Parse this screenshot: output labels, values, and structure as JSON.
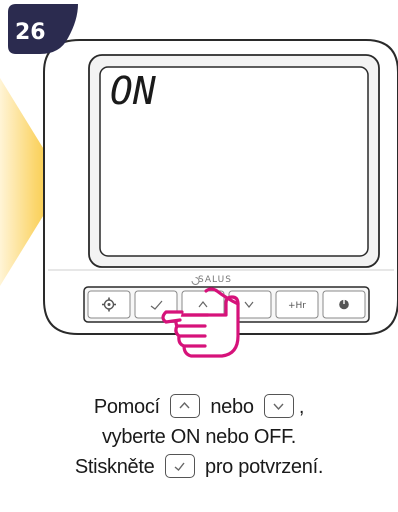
{
  "step": {
    "number": "26",
    "badge_color": "#2b2b4f"
  },
  "device": {
    "display_text": "ON",
    "brand": "SALUS",
    "buttons": [
      {
        "name": "settings",
        "icon": "gear-icon"
      },
      {
        "name": "confirm",
        "icon": "check-icon"
      },
      {
        "name": "up",
        "icon": "chevron-up-icon"
      },
      {
        "name": "down",
        "icon": "chevron-down-icon"
      },
      {
        "name": "plus-hour",
        "label": "+Hr"
      },
      {
        "name": "power",
        "icon": "power-icon"
      }
    ]
  },
  "hand_color": "#d6127a",
  "arrow_color": "#f6c22a",
  "instructions": {
    "line1_part1": "Pomocí",
    "line1_part2": "nebo",
    "line1_part3": ",",
    "line2": "vyberte ON nebo OFF.",
    "line3_part1": "Stiskněte",
    "line3_part2": "pro potvrzení."
  }
}
